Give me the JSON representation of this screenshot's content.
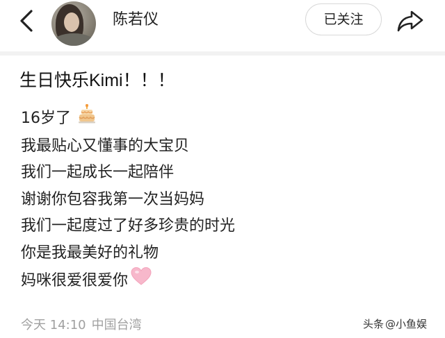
{
  "header": {
    "back_icon": "chevron-left-icon",
    "username": "陈若仪",
    "follow_label": "已关注",
    "share_icon": "share-arrow-icon"
  },
  "post": {
    "title": "生日快乐Kimi！！！",
    "lines": [
      "16岁了",
      "我最贴心又懂事的大宝贝",
      "我们一起成长一起陪伴",
      "谢谢你包容我第一次当妈妈",
      "我们一起度过了好多珍贵的时光",
      "你是我最美好的礼物",
      "妈咪很爱很爱你"
    ],
    "line_emojis": [
      "birthday-cake-icon",
      "",
      "",
      "",
      "",
      "",
      "pink-heart-icon"
    ],
    "time": "今天 14:10",
    "location": "中国台湾"
  },
  "watermark": {
    "source": "头条",
    "handle": "@小鱼娱"
  },
  "colors": {
    "text": "#222222",
    "meta": "#a0a0a0",
    "divider": "#f2f2f2",
    "heart": "#f7b8cb"
  }
}
